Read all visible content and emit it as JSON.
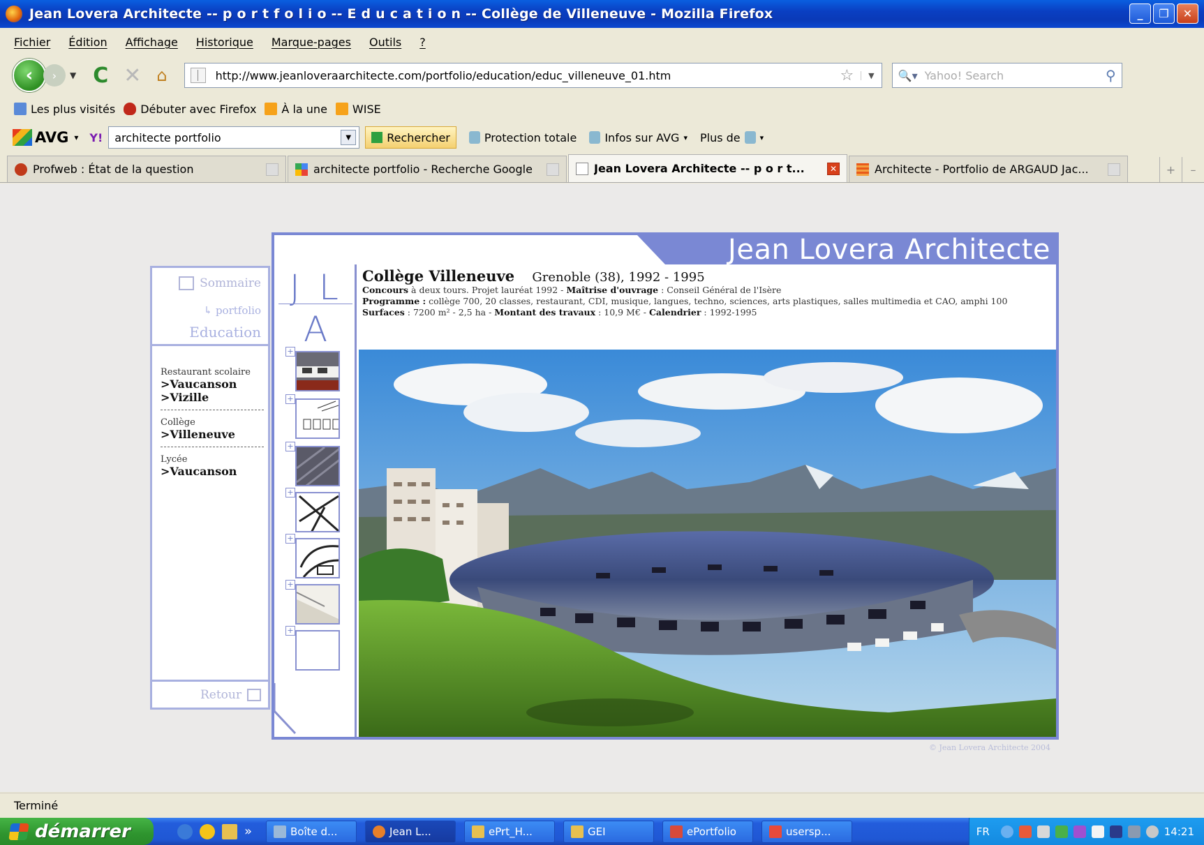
{
  "window": {
    "title": "Jean Lovera Architecte -- p o r t f o l i o -- E d u c a t i o n -- Collège de Villeneuve - Mozilla Firefox"
  },
  "menu": [
    "Fichier",
    "Édition",
    "Affichage",
    "Historique",
    "Marque-pages",
    "Outils",
    "?"
  ],
  "nav": {
    "url": "http://www.jeanloveraarchitecte.com/portfolio/education/educ_villeneuve_01.htm",
    "search_placeholder": "Yahoo! Search"
  },
  "bookmarks": [
    "Les plus visités",
    "Débuter avec Firefox",
    "À la une",
    "WISE"
  ],
  "avg": {
    "logo": "AVG",
    "yahoo": "Y!",
    "query": "architecte portfolio",
    "search_button": "Rechercher",
    "items": [
      "Protection totale",
      "Infos sur AVG",
      "Plus de"
    ]
  },
  "tabs": [
    {
      "label": "Profweb : État de la question"
    },
    {
      "label": "architecte portfolio - Recherche Google"
    },
    {
      "label": "Jean Lovera Architecte -- p o r t..."
    },
    {
      "label": "Architecte - Portfolio de ARGAUD Jac..."
    }
  ],
  "site": {
    "banner": "Jean Lovera Architecte",
    "sommaire": "Sommaire",
    "portfolio_link": "↳ portfolio",
    "section": "Education",
    "retour": "Retour",
    "logo": {
      "j": "J",
      "l": "L",
      "a": "A"
    },
    "nav": [
      {
        "category": "Restaurant scolaire",
        "items": [
          ">Vaucanson",
          ">Vizille"
        ]
      },
      {
        "category": "Collège",
        "items": [
          ">Villeneuve"
        ]
      },
      {
        "category": "Lycée",
        "items": [
          ">Vaucanson"
        ]
      }
    ],
    "project": {
      "title": "Collège Villeneuve",
      "location": "Grenoble (38), 1992 - 1995",
      "concours_label": "Concours",
      "concours_text": " à deux tours. Projet lauréat 1992 - ",
      "maitrise_label": "Maîtrise d'ouvrage",
      "maitrise_text": " : Conseil Général de l'Isère",
      "programme_label": "Programme :",
      "programme_text": " collège 700, 20 classes, restaurant, CDI, musique, langues, techno, sciences, arts plastiques, salles multimedia et CAO, amphi 100",
      "surfaces_label": "Surfaces",
      "surfaces_text": " : 7200 m² - 2,5 ha - ",
      "montant_label": "Montant des travaux",
      "montant_text": " : 10,9 M€ - ",
      "calendrier_label": "Calendrier",
      "calendrier_text": " : 1992-1995"
    },
    "copyright": "© Jean Lovera Architecte 2004",
    "thumbs": [
      "plus",
      "plus",
      "plus",
      "plus",
      "plus",
      "plus",
      "plus"
    ]
  },
  "status": "Terminé",
  "taskbar": {
    "start": "démarrer",
    "tasks": [
      "Boîte d...",
      "Jean L...",
      "ePrt_H...",
      "GEI",
      "ePortfolio",
      "usersp..."
    ],
    "active_task": 1,
    "lang": "FR",
    "clock": "14:21"
  },
  "colors": {
    "site_accent": "#7a88d4",
    "titlebar": "#0a3fc2",
    "taskbar": "#235ddc",
    "start": "#2e942e"
  }
}
